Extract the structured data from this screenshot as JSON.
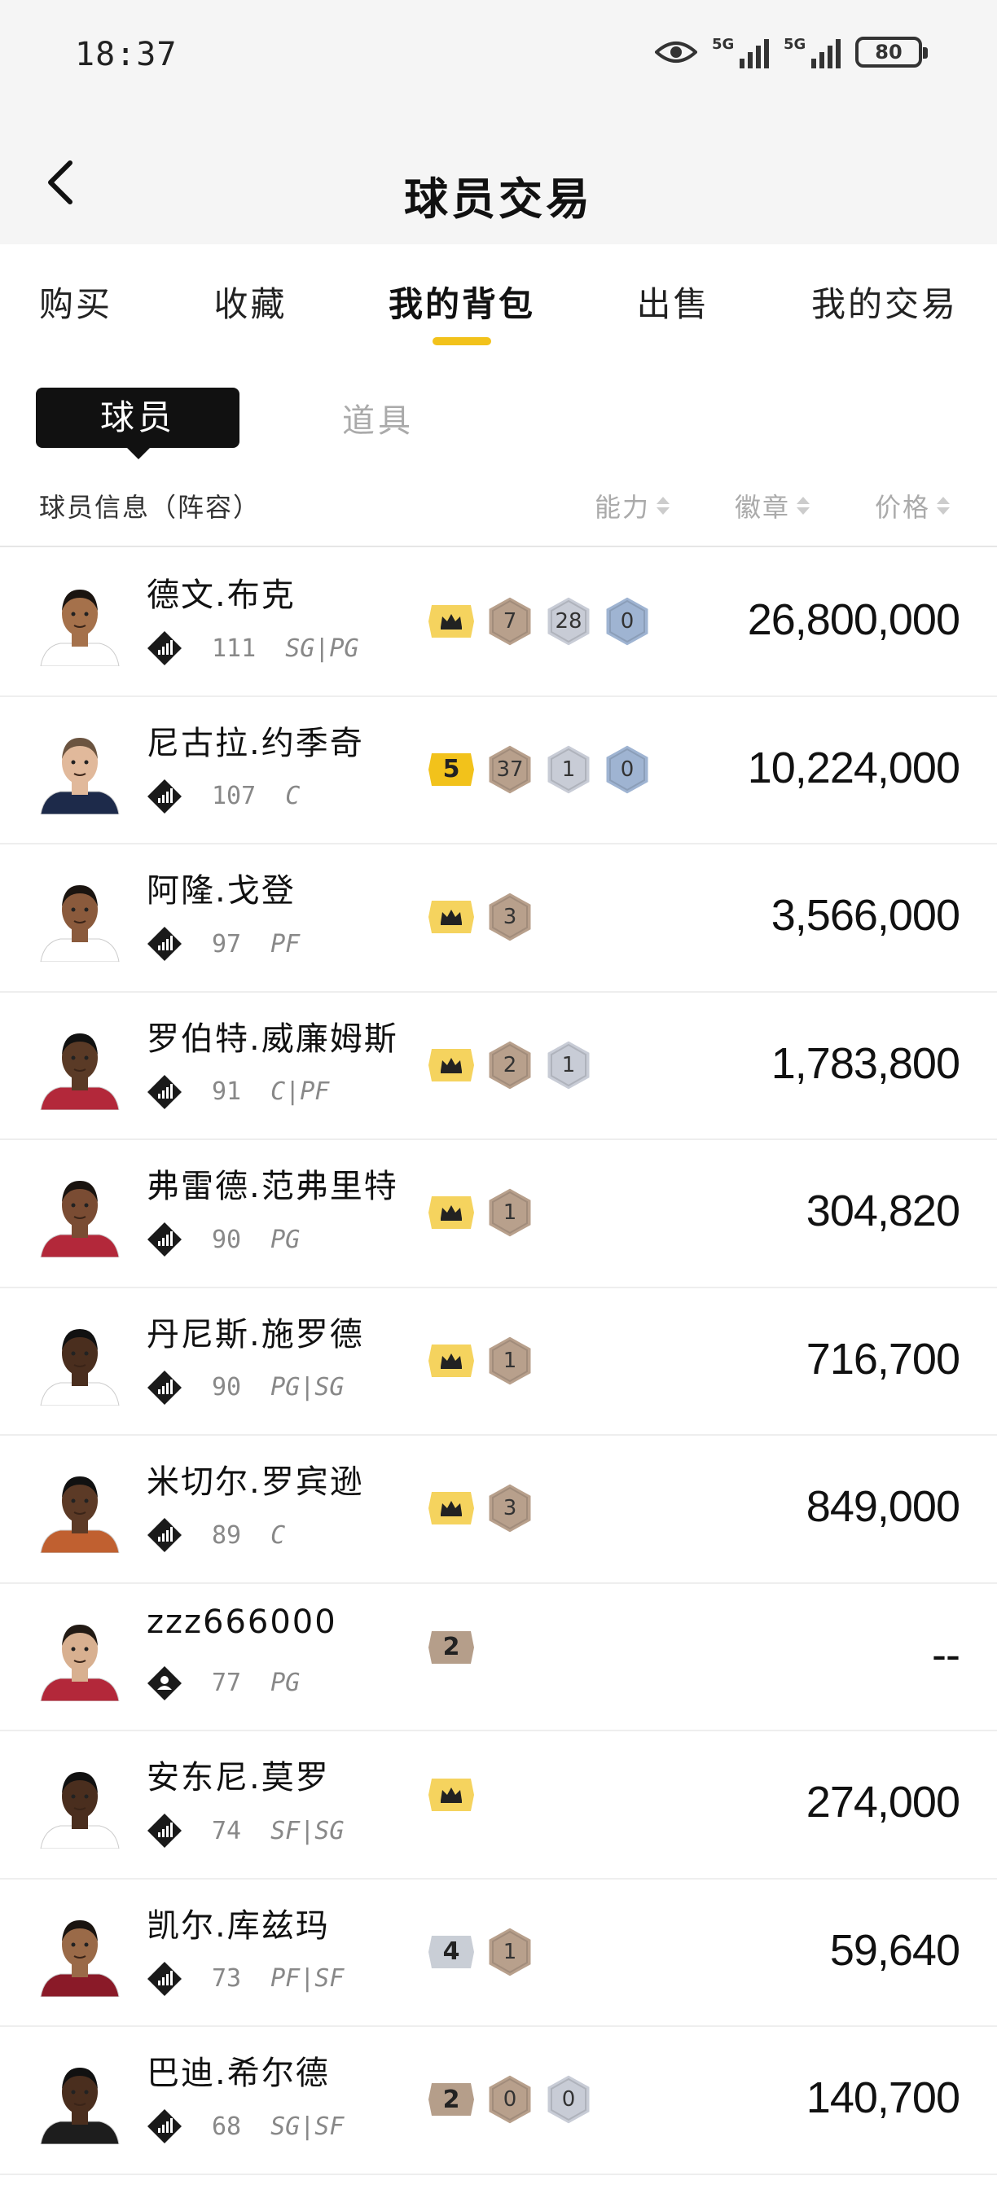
{
  "status": {
    "time": "18:37",
    "battery": "80",
    "net1": "5G",
    "net2": "5G"
  },
  "header": {
    "title": "球员交易"
  },
  "tabs": [
    "购买",
    "收藏",
    "我的背包",
    "出售",
    "我的交易"
  ],
  "subtabs": {
    "active": "球员",
    "inactive": "道具"
  },
  "columns": {
    "info": "球员信息（阵容）",
    "ability": "能力",
    "badge": "徽章",
    "price": "价格"
  },
  "players": [
    {
      "name": "德文.布克",
      "ovr": "111",
      "pos": "SG|PG",
      "tier": "crown",
      "counts": [
        "7",
        "28",
        "0"
      ],
      "price": "26,800,000",
      "skin": "#a5714b",
      "hair": "#1a1410",
      "jersey": "#ffffff"
    },
    {
      "name": "尼古拉.约季奇",
      "ovr": "107",
      "pos": "C",
      "tier": "5",
      "counts": [
        "37",
        "1",
        "0"
      ],
      "price": "10,224,000",
      "skin": "#e1b99b",
      "hair": "#6b5440",
      "jersey": "#1d2a4a"
    },
    {
      "name": "阿隆.戈登",
      "ovr": "97",
      "pos": "PF",
      "tier": "crown",
      "counts": [
        "3"
      ],
      "price": "3,566,000",
      "skin": "#8a5a3c",
      "hair": "#1a1410",
      "jersey": "#ffffff"
    },
    {
      "name": "罗伯特.威廉姆斯",
      "ovr": "91",
      "pos": "C|PF",
      "tier": "crown",
      "counts": [
        "2",
        "1"
      ],
      "price": "1,783,800",
      "skin": "#5a3a26",
      "hair": "#111111",
      "jersey": "#b3283a"
    },
    {
      "name": "弗雷德.范弗里特",
      "ovr": "90",
      "pos": "PG",
      "tier": "crown",
      "counts": [
        "1"
      ],
      "price": "304,820",
      "skin": "#7a4c33",
      "hair": "#1a1410",
      "jersey": "#b3283a"
    },
    {
      "name": "丹尼斯.施罗德",
      "ovr": "90",
      "pos": "PG|SG",
      "tier": "crown",
      "counts": [
        "1"
      ],
      "price": "716,700",
      "skin": "#4a2e1e",
      "hair": "#111111",
      "jersey": "#ffffff"
    },
    {
      "name": "米切尔.罗宾逊",
      "ovr": "89",
      "pos": "C",
      "tier": "crown",
      "counts": [
        "3"
      ],
      "price": "849,000",
      "skin": "#5c3a26",
      "hair": "#111111",
      "jersey": "#c06030"
    },
    {
      "name": "zzz666000",
      "ovr": "77",
      "pos": "PG",
      "tier": "2",
      "counts": [],
      "price": "--",
      "skin": "#d8b090",
      "hair": "#221a14",
      "jersey": "#b3283a"
    },
    {
      "name": "安东尼.莫罗",
      "ovr": "74",
      "pos": "SF|SG",
      "tier": "crown",
      "counts": [],
      "price": "274,000",
      "skin": "#4a2e1e",
      "hair": "#111111",
      "jersey": "#ffffff"
    },
    {
      "name": "凯尔.库兹玛",
      "ovr": "73",
      "pos": "PF|SF",
      "tier": "4",
      "counts": [
        "1"
      ],
      "price": "59,640",
      "skin": "#9a6a48",
      "hair": "#1a1410",
      "jersey": "#8a1a28"
    },
    {
      "name": "巴迪.希尔德",
      "ovr": "68",
      "pos": "SG|SF",
      "tier": "2",
      "counts": [
        "0",
        "0"
      ],
      "price": "140,700",
      "skin": "#4a2e1e",
      "hair": "#111111",
      "jersey": "#1d1d1d"
    }
  ],
  "colors": {
    "accent": "#f2c21b",
    "crown_tag": "#f5d35e",
    "tier5_tag": "#f2c21b",
    "tier4_tag": "#c9ced6",
    "tier2_tag": "#b59e8a",
    "hex_bronze": "#b8a08c",
    "hex_silver": "#c8ccd6",
    "hex_blue": "#9fb4d2"
  }
}
